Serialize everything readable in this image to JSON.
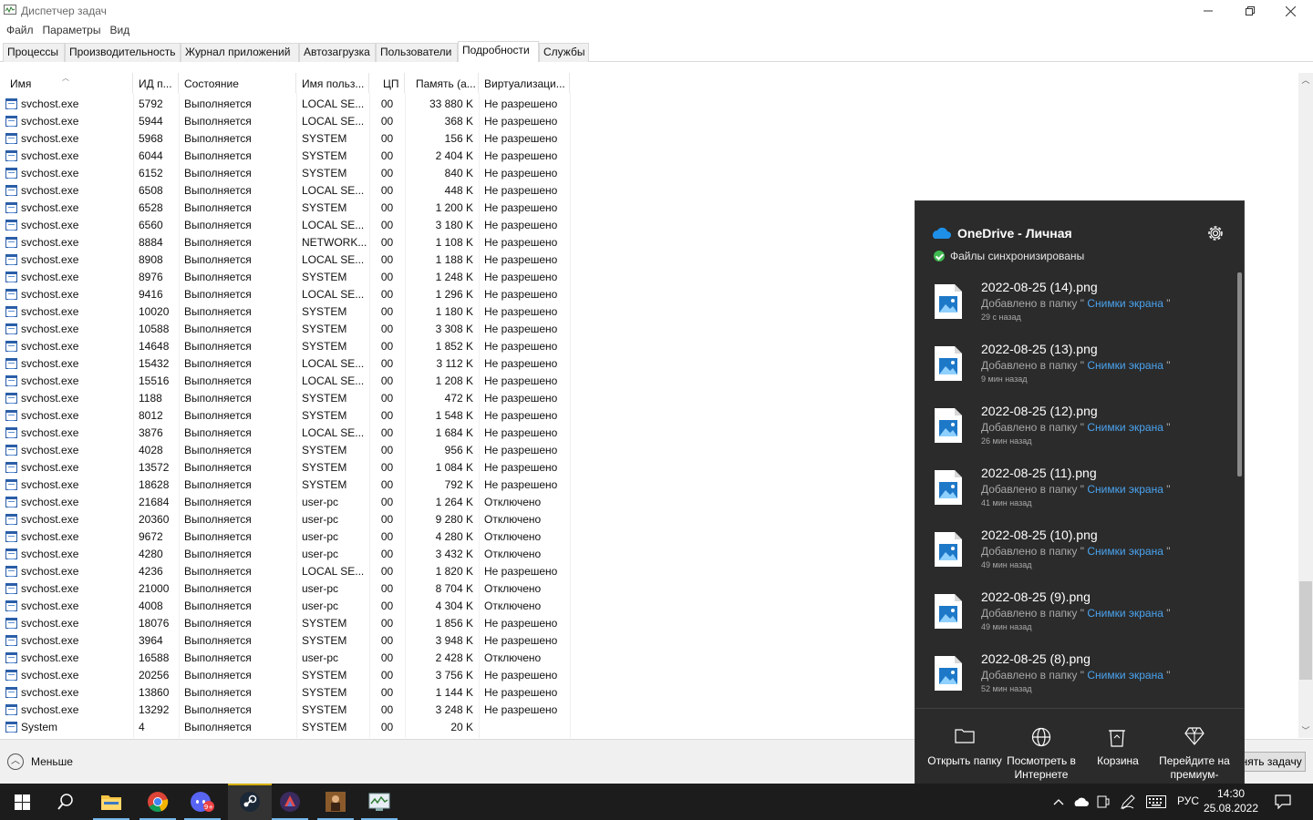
{
  "window": {
    "title": "Диспетчер задач",
    "minimize": "—",
    "maximize": "❐",
    "close": "✕"
  },
  "menu": [
    "Файл",
    "Параметры",
    "Вид"
  ],
  "tabs": [
    "Процессы",
    "Производительность",
    "Журнал приложений",
    "Автозагрузка",
    "Пользователи",
    "Подробности",
    "Службы"
  ],
  "active_tab": "Подробности",
  "columns": [
    "Имя",
    "ИД п...",
    "Состояние",
    "Имя польз...",
    "ЦП",
    "Память (а...",
    "Виртуализаци..."
  ],
  "rows": [
    [
      "svchost.exe",
      "5792",
      "Выполняется",
      "LOCAL SE...",
      "00",
      "33 880 K",
      "Не разрешено"
    ],
    [
      "svchost.exe",
      "5944",
      "Выполняется",
      "LOCAL SE...",
      "00",
      "368 K",
      "Не разрешено"
    ],
    [
      "svchost.exe",
      "5968",
      "Выполняется",
      "SYSTEM",
      "00",
      "156 K",
      "Не разрешено"
    ],
    [
      "svchost.exe",
      "6044",
      "Выполняется",
      "SYSTEM",
      "00",
      "2 404 K",
      "Не разрешено"
    ],
    [
      "svchost.exe",
      "6152",
      "Выполняется",
      "SYSTEM",
      "00",
      "840 K",
      "Не разрешено"
    ],
    [
      "svchost.exe",
      "6508",
      "Выполняется",
      "LOCAL SE...",
      "00",
      "448 K",
      "Не разрешено"
    ],
    [
      "svchost.exe",
      "6528",
      "Выполняется",
      "SYSTEM",
      "00",
      "1 200 K",
      "Не разрешено"
    ],
    [
      "svchost.exe",
      "6560",
      "Выполняется",
      "LOCAL SE...",
      "00",
      "3 180 K",
      "Не разрешено"
    ],
    [
      "svchost.exe",
      "8884",
      "Выполняется",
      "NETWORK...",
      "00",
      "1 108 K",
      "Не разрешено"
    ],
    [
      "svchost.exe",
      "8908",
      "Выполняется",
      "LOCAL SE...",
      "00",
      "1 188 K",
      "Не разрешено"
    ],
    [
      "svchost.exe",
      "8976",
      "Выполняется",
      "SYSTEM",
      "00",
      "1 248 K",
      "Не разрешено"
    ],
    [
      "svchost.exe",
      "9416",
      "Выполняется",
      "LOCAL SE...",
      "00",
      "1 296 K",
      "Не разрешено"
    ],
    [
      "svchost.exe",
      "10020",
      "Выполняется",
      "SYSTEM",
      "00",
      "1 180 K",
      "Не разрешено"
    ],
    [
      "svchost.exe",
      "10588",
      "Выполняется",
      "SYSTEM",
      "00",
      "3 308 K",
      "Не разрешено"
    ],
    [
      "svchost.exe",
      "14648",
      "Выполняется",
      "SYSTEM",
      "00",
      "1 852 K",
      "Не разрешено"
    ],
    [
      "svchost.exe",
      "15432",
      "Выполняется",
      "LOCAL SE...",
      "00",
      "3 112 K",
      "Не разрешено"
    ],
    [
      "svchost.exe",
      "15516",
      "Выполняется",
      "LOCAL SE...",
      "00",
      "1 208 K",
      "Не разрешено"
    ],
    [
      "svchost.exe",
      "1188",
      "Выполняется",
      "SYSTEM",
      "00",
      "472 K",
      "Не разрешено"
    ],
    [
      "svchost.exe",
      "8012",
      "Выполняется",
      "SYSTEM",
      "00",
      "1 548 K",
      "Не разрешено"
    ],
    [
      "svchost.exe",
      "3876",
      "Выполняется",
      "LOCAL SE...",
      "00",
      "1 684 K",
      "Не разрешено"
    ],
    [
      "svchost.exe",
      "4028",
      "Выполняется",
      "SYSTEM",
      "00",
      "956 K",
      "Не разрешено"
    ],
    [
      "svchost.exe",
      "13572",
      "Выполняется",
      "SYSTEM",
      "00",
      "1 084 K",
      "Не разрешено"
    ],
    [
      "svchost.exe",
      "18628",
      "Выполняется",
      "SYSTEM",
      "00",
      "792 K",
      "Не разрешено"
    ],
    [
      "svchost.exe",
      "21684",
      "Выполняется",
      "user-pc",
      "00",
      "1 264 K",
      "Отключено"
    ],
    [
      "svchost.exe",
      "20360",
      "Выполняется",
      "user-pc",
      "00",
      "9 280 K",
      "Отключено"
    ],
    [
      "svchost.exe",
      "9672",
      "Выполняется",
      "user-pc",
      "00",
      "4 280 K",
      "Отключено"
    ],
    [
      "svchost.exe",
      "4280",
      "Выполняется",
      "user-pc",
      "00",
      "3 432 K",
      "Отключено"
    ],
    [
      "svchost.exe",
      "4236",
      "Выполняется",
      "LOCAL SE...",
      "00",
      "1 820 K",
      "Не разрешено"
    ],
    [
      "svchost.exe",
      "21000",
      "Выполняется",
      "user-pc",
      "00",
      "8 704 K",
      "Отключено"
    ],
    [
      "svchost.exe",
      "4008",
      "Выполняется",
      "user-pc",
      "00",
      "4 304 K",
      "Отключено"
    ],
    [
      "svchost.exe",
      "18076",
      "Выполняется",
      "SYSTEM",
      "00",
      "1 856 K",
      "Не разрешено"
    ],
    [
      "svchost.exe",
      "3964",
      "Выполняется",
      "SYSTEM",
      "00",
      "3 948 K",
      "Не разрешено"
    ],
    [
      "svchost.exe",
      "16588",
      "Выполняется",
      "user-pc",
      "00",
      "2 428 K",
      "Отключено"
    ],
    [
      "svchost.exe",
      "20256",
      "Выполняется",
      "SYSTEM",
      "00",
      "3 756 K",
      "Не разрешено"
    ],
    [
      "svchost.exe",
      "13860",
      "Выполняется",
      "SYSTEM",
      "00",
      "1 144 K",
      "Не разрешено"
    ],
    [
      "svchost.exe",
      "13292",
      "Выполняется",
      "SYSTEM",
      "00",
      "3 248 K",
      "Не разрешено"
    ],
    [
      "System",
      "4",
      "Выполняется",
      "SYSTEM",
      "00",
      "20 K",
      ""
    ]
  ],
  "bottom": {
    "less_label": "Меньше",
    "end_task_label": "Снять задачу"
  },
  "onedrive": {
    "title": "OneDrive - Личная",
    "status": "Файлы синхронизированы",
    "added_prefix": "Добавлено в папку \"",
    "folder": " Снимки экрана ",
    "added_suffix": "\"",
    "items": [
      {
        "name": "2022-08-25 (14).png",
        "time": "29 с назад"
      },
      {
        "name": "2022-08-25 (13).png",
        "time": "9 мин назад"
      },
      {
        "name": "2022-08-25 (12).png",
        "time": "26 мин назад"
      },
      {
        "name": "2022-08-25 (11).png",
        "time": "41 мин назад"
      },
      {
        "name": "2022-08-25 (10).png",
        "time": "49 мин назад"
      },
      {
        "name": "2022-08-25 (9).png",
        "time": "49 мин назад"
      },
      {
        "name": "2022-08-25 (8).png",
        "time": "52 мин назад"
      }
    ],
    "actions": [
      {
        "icon": "folder-icon",
        "label": "Открыть папку"
      },
      {
        "icon": "globe-icon",
        "label": "Посмотреть в Интернете"
      },
      {
        "icon": "recycle-bin-icon",
        "label": "Корзина"
      },
      {
        "icon": "diamond-icon",
        "label": "Перейдите на премиум-"
      }
    ],
    "accent": "#4aa3ef"
  },
  "taskbar": {
    "apps": [
      "start-icon",
      "search-icon",
      "file-explorer-icon",
      "chrome-icon",
      "discord-icon",
      "steam-icon",
      "app-icon",
      "game-icon",
      "task-manager-icon"
    ],
    "discord_badge": "9+",
    "language": "РУС",
    "time": "14:30",
    "date": "25.08.2022"
  }
}
